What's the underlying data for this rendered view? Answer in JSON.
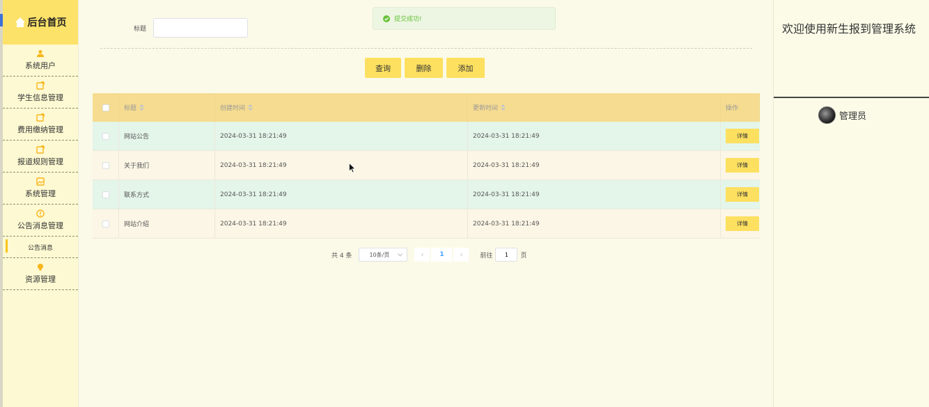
{
  "sidebar": {
    "home_label": "后台首页",
    "items": [
      {
        "label": "系统用户",
        "icon": "user-icon"
      },
      {
        "label": "学生信息管理",
        "icon": "edit-icon"
      },
      {
        "label": "费用缴纳管理",
        "icon": "edit-icon"
      },
      {
        "label": "报道规则管理",
        "icon": "edit-icon"
      },
      {
        "label": "系统管理",
        "icon": "picture-icon"
      },
      {
        "label": "公告消息管理",
        "icon": "info-circle-icon"
      },
      {
        "label": "资源管理",
        "icon": "bulb-icon"
      }
    ],
    "active_submenu": "公告消息"
  },
  "search": {
    "label": "标题",
    "value": "",
    "placeholder": ""
  },
  "toast": {
    "message": "提交成功!",
    "icon": "success-check-icon",
    "color": "#67c23a"
  },
  "buttons": {
    "query": "查询",
    "delete": "删除",
    "add": "添加"
  },
  "table": {
    "columns": [
      "标题",
      "创建时间",
      "更新时间",
      "操作"
    ],
    "rows": [
      {
        "title": "网站公告",
        "created": "2024-03-31 18:21:49",
        "updated": "2024-03-31 18:21:49",
        "action": "详情"
      },
      {
        "title": "关于我们",
        "created": "2024-03-31 18:21:49",
        "updated": "2024-03-31 18:21:49",
        "action": "详情"
      },
      {
        "title": "联系方式",
        "created": "2024-03-31 18:21:49",
        "updated": "2024-03-31 18:21:49",
        "action": "详情"
      },
      {
        "title": "网站介绍",
        "created": "2024-03-31 18:21:49",
        "updated": "2024-03-31 18:21:49",
        "action": "详情"
      }
    ]
  },
  "pagination": {
    "total": "共 4 条",
    "page_size": "10条/页",
    "current_page": "1",
    "goto_label": "前往",
    "goto_value": "1",
    "page_suffix": "页"
  },
  "header": {
    "welcome": "欢迎使用新生报到管理系统",
    "user_name": "管理员"
  },
  "colors": {
    "accent": "#fde060",
    "sidebar_head": "#fde26a",
    "table_header": "#f6dc90",
    "row_alt": "#e4f5ea"
  }
}
